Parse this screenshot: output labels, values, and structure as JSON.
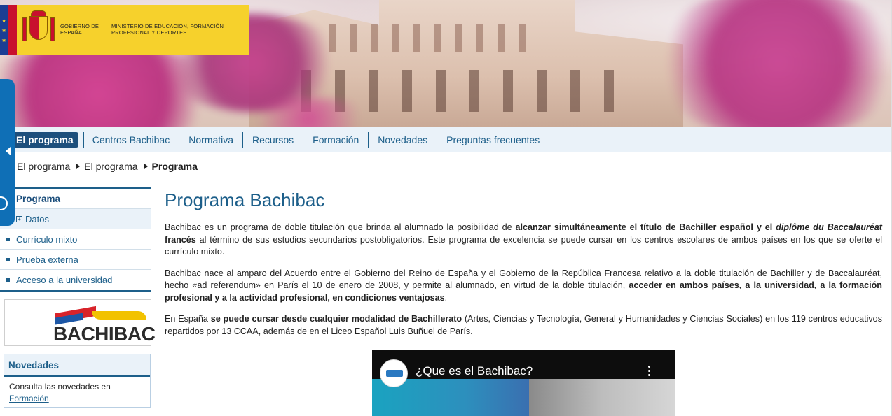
{
  "header": {
    "gobierno": "GOBIERNO DE ESPAÑA",
    "ministerio": "MINISTERIO DE EDUCACIÓN, FORMACIÓN PROFESIONAL Y DEPORTES"
  },
  "nav": {
    "items": [
      {
        "label": "El programa",
        "active": true
      },
      {
        "label": "Centros Bachibac"
      },
      {
        "label": "Normativa"
      },
      {
        "label": "Recursos"
      },
      {
        "label": "Formación"
      },
      {
        "label": "Novedades"
      },
      {
        "label": "Preguntas frecuentes"
      }
    ]
  },
  "breadcrumb": {
    "items": [
      "El programa",
      "El programa"
    ],
    "current": "Programa"
  },
  "sidebar": {
    "items": [
      {
        "label": "Programa"
      },
      {
        "label": "Datos"
      },
      {
        "label": "Currículo mixto"
      },
      {
        "label": "Prueba externa"
      },
      {
        "label": "Acceso a la universidad"
      }
    ],
    "logo_text": "BACHIBAC",
    "news": {
      "title": "Novedades",
      "text": "Consulta las novedades en",
      "link": "Formación",
      "period": "."
    }
  },
  "main": {
    "title": "Programa Bachibac",
    "p1": {
      "a": "Bachibac es un programa de doble titulación que brinda al alumnado la posibilidad de ",
      "b": "alcanzar simultáneamente el título de Bachiller español y el ",
      "c": "diplôme du Baccalauréat",
      "d": " francés",
      "e": " al término de sus estudios secundarios postobligatorios. Este programa de excelencia se puede cursar en los centros escolares de ambos países en los que se oferte el currículo mixto."
    },
    "p2": {
      "a": "Bachibac nace al amparo del Acuerdo entre el Gobierno del Reino de España y el Gobierno de la República Francesa relativo a la doble titulación de Bachiller y de Baccalauréat, hecho «ad referendum» en París el 10 de enero de 2008, y permite al alumnado, en virtud de la doble titulación, ",
      "b": "acceder en ambos países, a la universidad, a la formación profesional y a la actividad profesional, en condiciones ventajosas",
      "c": "."
    },
    "p3": {
      "a": "En España ",
      "b": "se puede cursar desde cualquier modalidad de Bachillerato",
      "c": " (Artes, Ciencias y Tecnología, General y Humanidades y Ciencias Sociales) en los 119 centros educativos repartidos por 13 CCAA, además de en el Liceo Español Luis Buñuel de París."
    },
    "video": {
      "title": "¿Que es el Bachibac?"
    }
  }
}
